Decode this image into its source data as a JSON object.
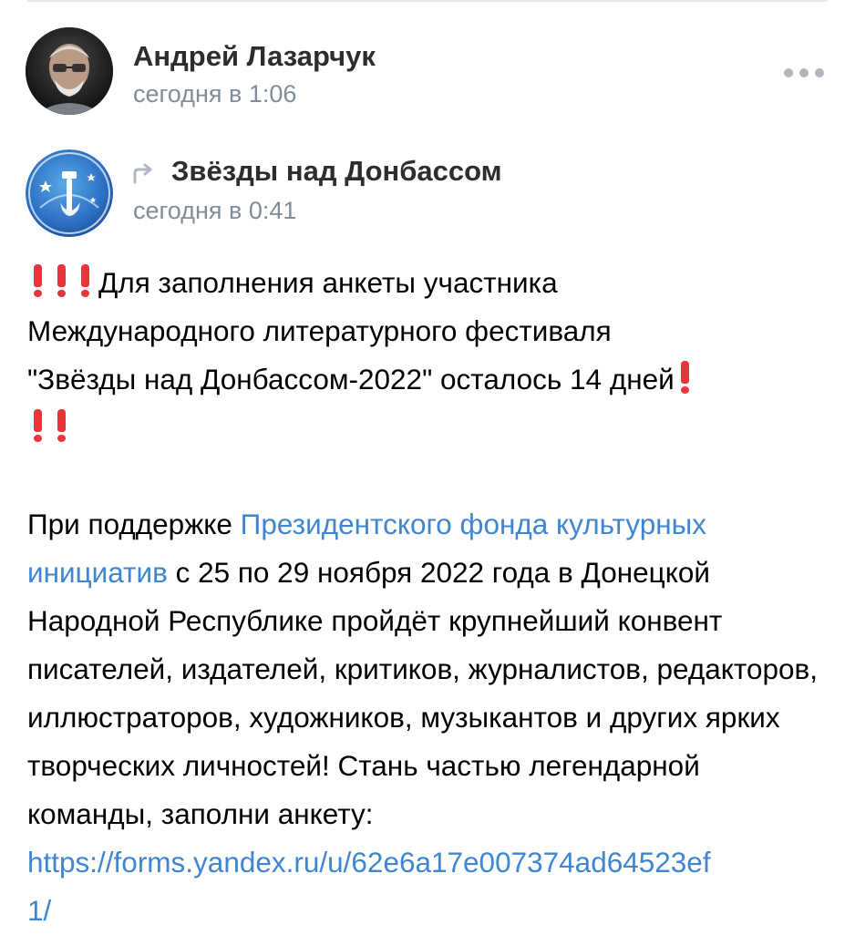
{
  "post": {
    "author_name": "Андрей Лазарчук",
    "time": "сегодня в 1:06",
    "more_icon": "more-horizontal-icon"
  },
  "repost": {
    "icon": "repost-arrow-icon",
    "group_name": "Звёзды над Донбассом",
    "time": "сегодня в 0:41"
  },
  "text": {
    "line1_text": "Для заполнения анкеты участника",
    "line2": "Международного литературного фестиваля",
    "line3_text": "\"Звёзды над Донбассом-2022\" осталось 14 дней",
    "para2_before_link": "При поддержке ",
    "fund_link": "Президентского фонда культурных инициатив",
    "para2_after_link": " с 25 по 29 ноября 2022 года в Донецкой Народной Республике пройдёт крупнейший конвент писателей, издателей, критиков, журналистов, редакторов, иллюстраторов, художников, музыкантов и других ярких творческих личностей! Стань частью легендарной команды, заполни анкету:",
    "form_url_part1": "https://forms.yandex.ru/u/62e6a17e007374ad64523ef",
    "form_url_part2": "1/"
  },
  "colors": {
    "link": "#3f86d0",
    "meta_text": "#818c99",
    "exclamation": "#e8343a"
  }
}
